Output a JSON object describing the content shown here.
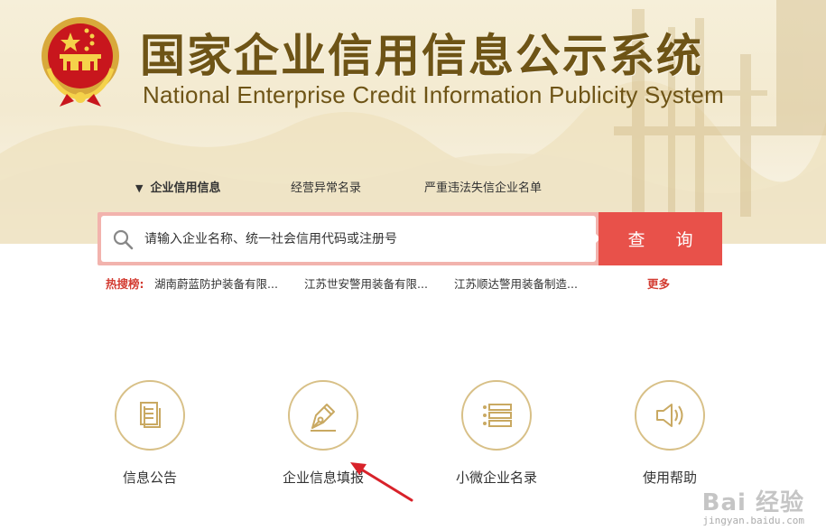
{
  "header": {
    "title_cn": "国家企业信用信息公示系统",
    "title_en": "National Enterprise Credit Information Publicity System"
  },
  "tabs": [
    {
      "label": "企业信用信息",
      "active": true
    },
    {
      "label": "经营异常名录",
      "active": false
    },
    {
      "label": "严重违法失信企业名单",
      "active": false
    }
  ],
  "search": {
    "placeholder": "请输入企业名称、统一社会信用代码或注册号",
    "button_label": "查 询"
  },
  "hot_search": {
    "label": "热搜榜:",
    "items": [
      "湖南蔚蓝防护装备有限...",
      "江苏世安警用装备有限...",
      "江苏顺达警用装备制造..."
    ],
    "more_label": "更多"
  },
  "features": [
    {
      "label": "信息公告",
      "icon": "document-icon"
    },
    {
      "label": "企业信息填报",
      "icon": "pen-nib-icon"
    },
    {
      "label": "小微企业名录",
      "icon": "list-icon"
    },
    {
      "label": "使用帮助",
      "icon": "speaker-icon"
    }
  ],
  "watermark": {
    "text": "Bai 经验",
    "url": "jingyan.baidu.com"
  },
  "colors": {
    "brand_gold": "#6e5416",
    "search_red": "#e8514a",
    "search_border": "#f2b3ad",
    "hot_red": "#d33c32",
    "circle_border": "#d8c087"
  }
}
